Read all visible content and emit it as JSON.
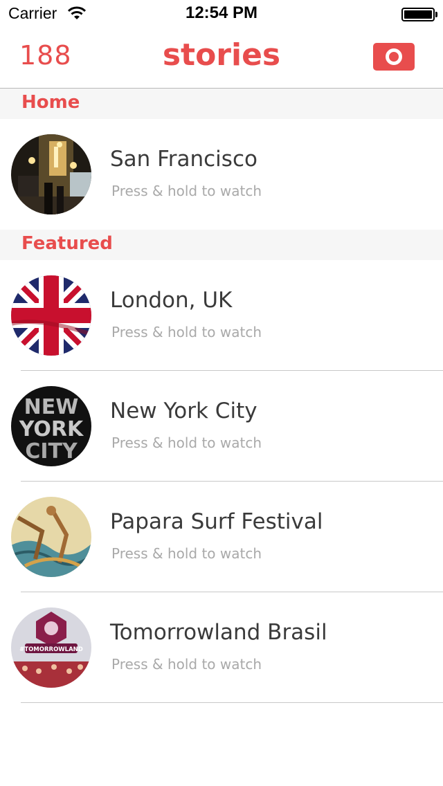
{
  "status_bar": {
    "carrier": "Carrier",
    "time": "12:54 PM",
    "wifi_icon": "wifi-icon",
    "battery_icon": "battery-icon"
  },
  "nav": {
    "count": "188",
    "title": "stories",
    "camera_icon": "camera-icon",
    "accent_color": "#e84d4d"
  },
  "sections": [
    {
      "header": "Home",
      "stories": [
        {
          "title": "San Francisco",
          "subtitle": "Press & hold to watch"
        }
      ]
    },
    {
      "header": "Featured",
      "stories": [
        {
          "title": "London, UK",
          "subtitle": "Press & hold to watch"
        },
        {
          "title": "New York City",
          "subtitle": "Press & hold to watch"
        },
        {
          "title": "Papara Surf Festival",
          "subtitle": "Press & hold to watch"
        },
        {
          "title": "Tomorrowland Brasil",
          "subtitle": "Press & hold to watch"
        }
      ]
    }
  ],
  "thumbnail_text": {
    "nyc": [
      "NEW",
      "YORK",
      "CITY"
    ],
    "tomorrowland": "#TOMORROWLAND"
  }
}
